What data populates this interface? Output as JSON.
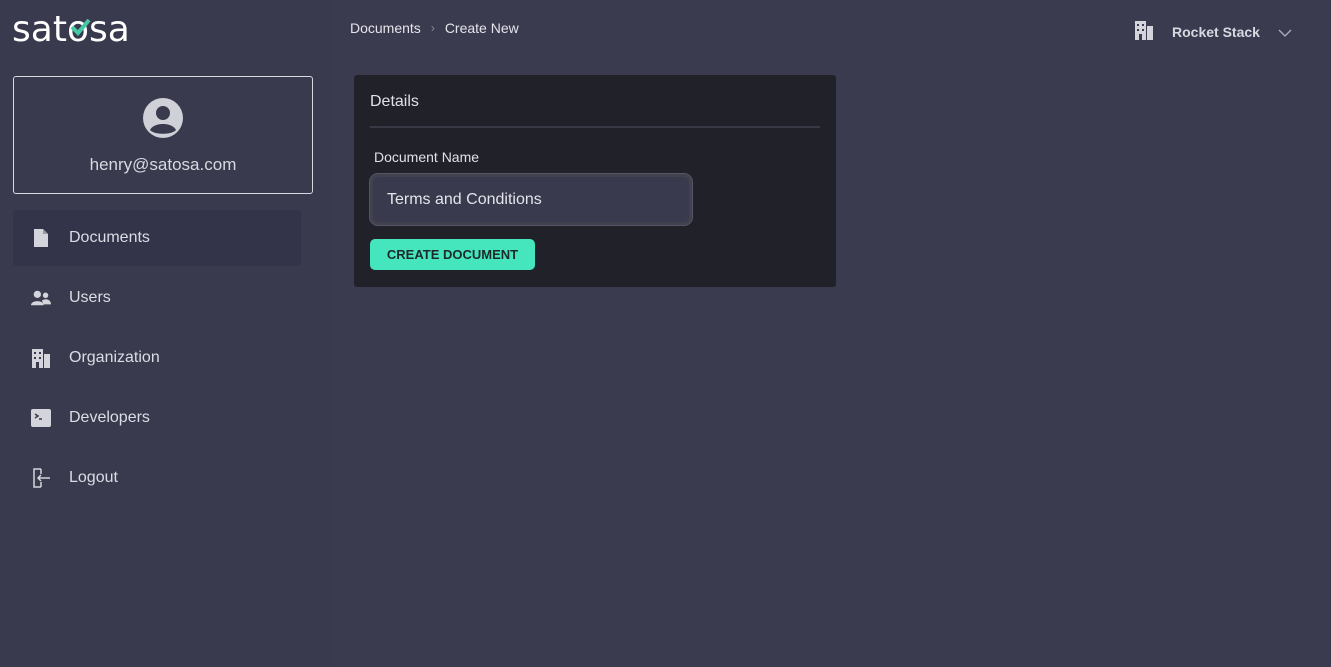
{
  "brand": {
    "logo_text": "satosa",
    "accent": "#45e6be"
  },
  "user": {
    "email": "henry@satosa.com"
  },
  "sidebar": {
    "items": [
      {
        "label": "Documents",
        "icon": "file-icon",
        "active": true
      },
      {
        "label": "Users",
        "icon": "users-icon"
      },
      {
        "label": "Organization",
        "icon": "building-icon"
      },
      {
        "label": "Developers",
        "icon": "terminal-icon"
      },
      {
        "label": "Logout",
        "icon": "logout-icon"
      }
    ]
  },
  "breadcrumb": {
    "items": [
      "Documents",
      "Create New"
    ]
  },
  "org_switcher": {
    "name": "Rocket Stack"
  },
  "details": {
    "title": "Details",
    "field_label": "Document Name",
    "field_value": "Terms and Conditions",
    "submit_label": "CREATE DOCUMENT"
  }
}
